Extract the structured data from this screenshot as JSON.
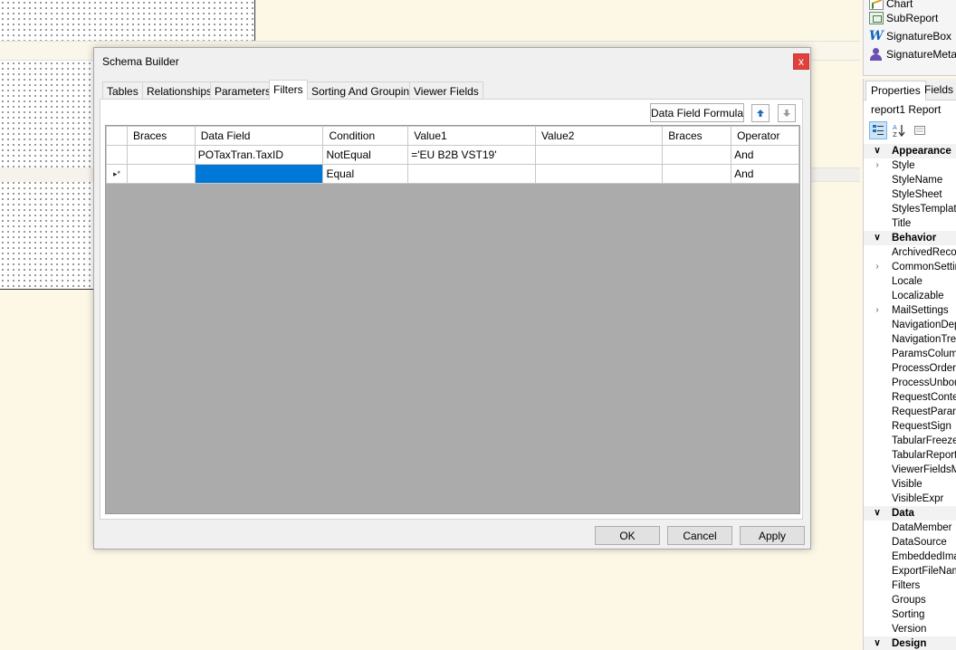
{
  "designer": {
    "toolbox": {
      "items": [
        {
          "label": "Chart",
          "icon": "chart-icon"
        },
        {
          "label": "SubReport",
          "icon": "subreport-icon"
        },
        {
          "label": "SignatureBox",
          "icon": "signature-icon"
        },
        {
          "label": "SignatureMetaB",
          "icon": "user-icon"
        }
      ]
    },
    "properties": {
      "tabs": [
        "Properties",
        "Fields"
      ],
      "object": "report1  Report",
      "toolbar": {
        "categorized": "categorized-icon",
        "alphabetical": "sort-az-icon",
        "pages": "property-pages-icon"
      },
      "rows": [
        {
          "label": "Appearance",
          "cat": true
        },
        {
          "label": "Style",
          "expand": true
        },
        {
          "label": "StyleName"
        },
        {
          "label": "StyleSheet"
        },
        {
          "label": "StylesTemplate"
        },
        {
          "label": "Title"
        },
        {
          "label": "Behavior",
          "cat": true
        },
        {
          "label": "ArchivedRecord"
        },
        {
          "label": "CommonSetting",
          "expand": true
        },
        {
          "label": "Locale"
        },
        {
          "label": "Localizable"
        },
        {
          "label": "MailSettings",
          "expand": true
        },
        {
          "label": "NavigationDept"
        },
        {
          "label": "NavigationTree"
        },
        {
          "label": "ParamsColumns"
        },
        {
          "label": "ProcessOrder"
        },
        {
          "label": "ProcessUnbou"
        },
        {
          "label": "RequestContex"
        },
        {
          "label": "RequestParams"
        },
        {
          "label": "RequestSign"
        },
        {
          "label": "TabularFreeze"
        },
        {
          "label": "TabularReport"
        },
        {
          "label": "ViewerFieldsMo"
        },
        {
          "label": "Visible"
        },
        {
          "label": "VisibleExpr"
        },
        {
          "label": "Data",
          "cat": true
        },
        {
          "label": "DataMember"
        },
        {
          "label": "DataSource"
        },
        {
          "label": "EmbeddedImag"
        },
        {
          "label": "ExportFileName"
        },
        {
          "label": "Filters"
        },
        {
          "label": "Groups"
        },
        {
          "label": "Sorting"
        },
        {
          "label": "Version"
        },
        {
          "label": "Design",
          "cat": true
        }
      ]
    }
  },
  "dialog": {
    "title": "Schema Builder",
    "close_glyph": "x",
    "tabs": [
      "Tables",
      "Relationships",
      "Parameters",
      "Filters",
      "Sorting And Grouping",
      "Viewer Fields"
    ],
    "active_tab": "Filters",
    "data_field_formula_label": "Data Field Formula",
    "move_up_icon": "arrow-up-icon",
    "move_down_icon": "arrow-down-icon",
    "grid": {
      "columns": [
        "Braces",
        "Data Field",
        "Condition",
        "Value1",
        "Value2",
        "Braces",
        "Operator"
      ],
      "rows": [
        {
          "indicator": "",
          "cells": [
            "",
            "POTaxTran.TaxID",
            "NotEqual",
            "='EU B2B VST19'",
            "",
            "",
            "And"
          ]
        },
        {
          "indicator": "▸*",
          "cells": [
            "",
            "",
            "Equal",
            "",
            "",
            "",
            "And"
          ]
        }
      ]
    },
    "buttons": {
      "ok": "OK",
      "cancel": "Cancel",
      "apply": "Apply"
    }
  }
}
